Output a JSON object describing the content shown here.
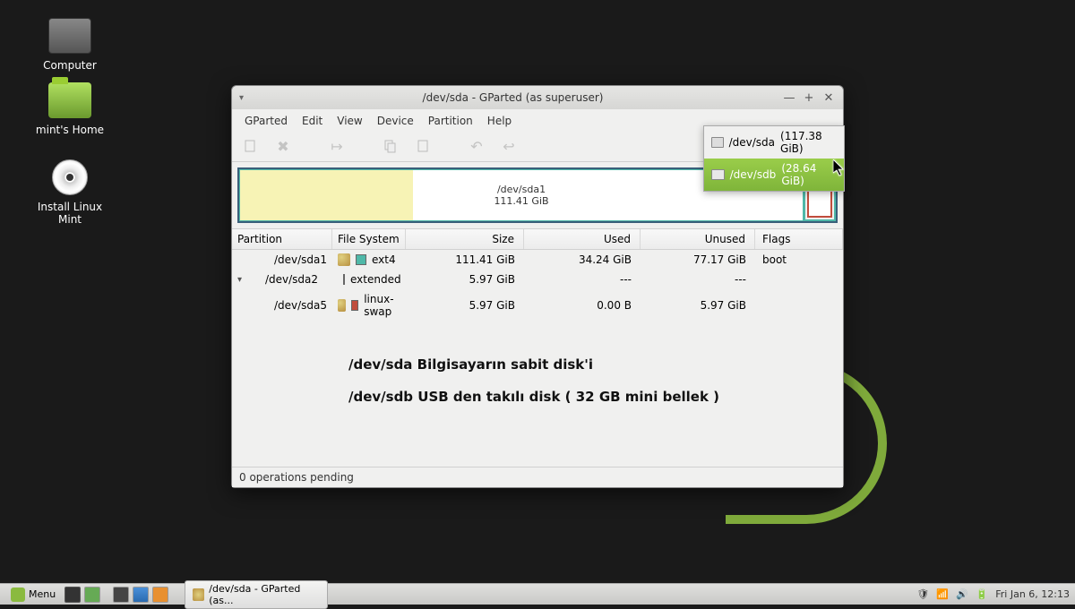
{
  "desktop": {
    "icons": [
      {
        "label": "Computer"
      },
      {
        "label": "mint's Home"
      },
      {
        "label": "Install Linux Mint"
      }
    ]
  },
  "window": {
    "title": "/dev/sda - GParted (as superuser)",
    "menus": [
      "GParted",
      "Edit",
      "View",
      "Device",
      "Partition",
      "Help"
    ],
    "devices": [
      {
        "path": "/dev/sda",
        "size": "(117.38 GiB)",
        "selected": false
      },
      {
        "path": "/dev/sdb",
        "size": "(28.64 GiB)",
        "selected": true
      }
    ],
    "vis": {
      "main_partition": "/dev/sda1",
      "main_size": "111.41 GiB"
    },
    "columns": {
      "partition": "Partition",
      "fs": "File System",
      "size": "Size",
      "used": "Used",
      "unused": "Unused",
      "flags": "Flags"
    },
    "rows": [
      {
        "indent": 1,
        "expander": "",
        "name": "/dev/sda1",
        "key": true,
        "swatch": "sw-ext4",
        "fs": "ext4",
        "size": "111.41 GiB",
        "used": "34.24 GiB",
        "unused": "77.17 GiB",
        "flags": "boot"
      },
      {
        "indent": 0,
        "expander": "▾",
        "name": "/dev/sda2",
        "key": true,
        "swatch": "sw-ext",
        "fs": "extended",
        "size": "5.97 GiB",
        "used": "---",
        "unused": "---",
        "flags": ""
      },
      {
        "indent": 2,
        "expander": "",
        "name": "/dev/sda5",
        "key": true,
        "swatch": "sw-swap",
        "fs": "linux-swap",
        "size": "5.97 GiB",
        "used": "0.00 B",
        "unused": "5.97 GiB",
        "flags": ""
      }
    ],
    "annotations": [
      "/dev/sda Bilgisayarın sabit disk'i",
      "/dev/sdb USB den takılı disk ( 32 GB mini bellek )"
    ],
    "status": "0 operations pending"
  },
  "taskbar": {
    "menu": "Menu",
    "app": "/dev/sda - GParted (as...",
    "clock": "Fri Jan  6, 12:13"
  }
}
